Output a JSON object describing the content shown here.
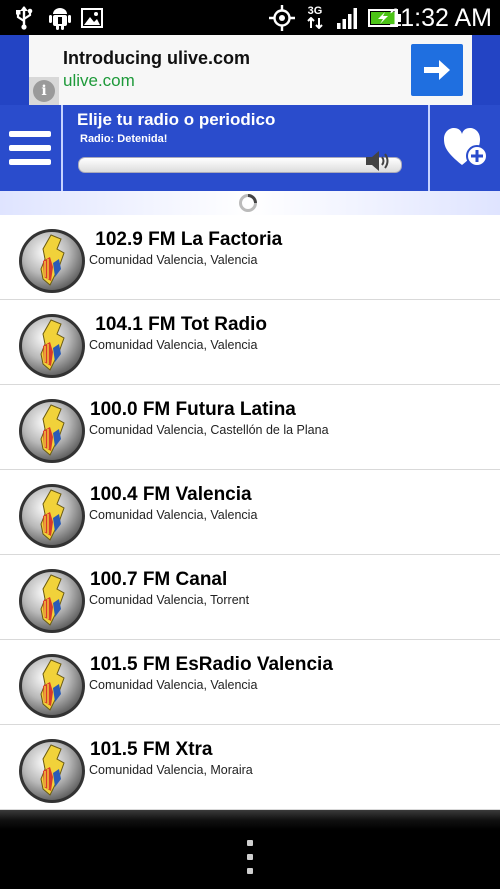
{
  "status_bar": {
    "time": "11:32 AM",
    "network": "3G",
    "icons": [
      "usb-icon",
      "android-debug-icon",
      "image-icon",
      "gps-icon",
      "network-3g-icon",
      "signal-icon",
      "battery-charging-icon"
    ]
  },
  "ad": {
    "title": "Introducing ulive.com",
    "url": "ulive.com",
    "info_glyph": "i",
    "action_icon": "arrow-right-icon"
  },
  "header": {
    "title": "Elije tu radio o periodico",
    "status": "Radio: Detenida!",
    "menu_icon": "hamburger-menu-icon",
    "volume_icon": "speaker-icon",
    "favorite_icon": "heart-add-icon"
  },
  "stations": [
    {
      "name": " 102.9 FM La Factoria",
      "region": "Comunidad Valencia",
      "city": "Valencia"
    },
    {
      "name": " 104.1 FM Tot Radio",
      "region": "Comunidad Valencia",
      "city": "Valencia"
    },
    {
      "name": "100.0 FM Futura Latina",
      "region": "Comunidad Valencia",
      "city": "Castellón de la Plana"
    },
    {
      "name": "100.4 FM Valencia",
      "region": "Comunidad Valencia",
      "city": "Valencia"
    },
    {
      "name": "100.7 FM Canal",
      "region": "Comunidad Valencia",
      "city": "Torrent"
    },
    {
      "name": "101.5 FM EsRadio Valencia",
      "region": "Comunidad Valencia",
      "city": "Valencia"
    },
    {
      "name": "101.5 FM Xtra",
      "region": "Comunidad Valencia",
      "city": "Moraira"
    }
  ],
  "colors": {
    "header_blue": "#2a4ccc",
    "ad_url_green": "#1e9a3a",
    "ad_button_blue": "#1f6fe0"
  }
}
